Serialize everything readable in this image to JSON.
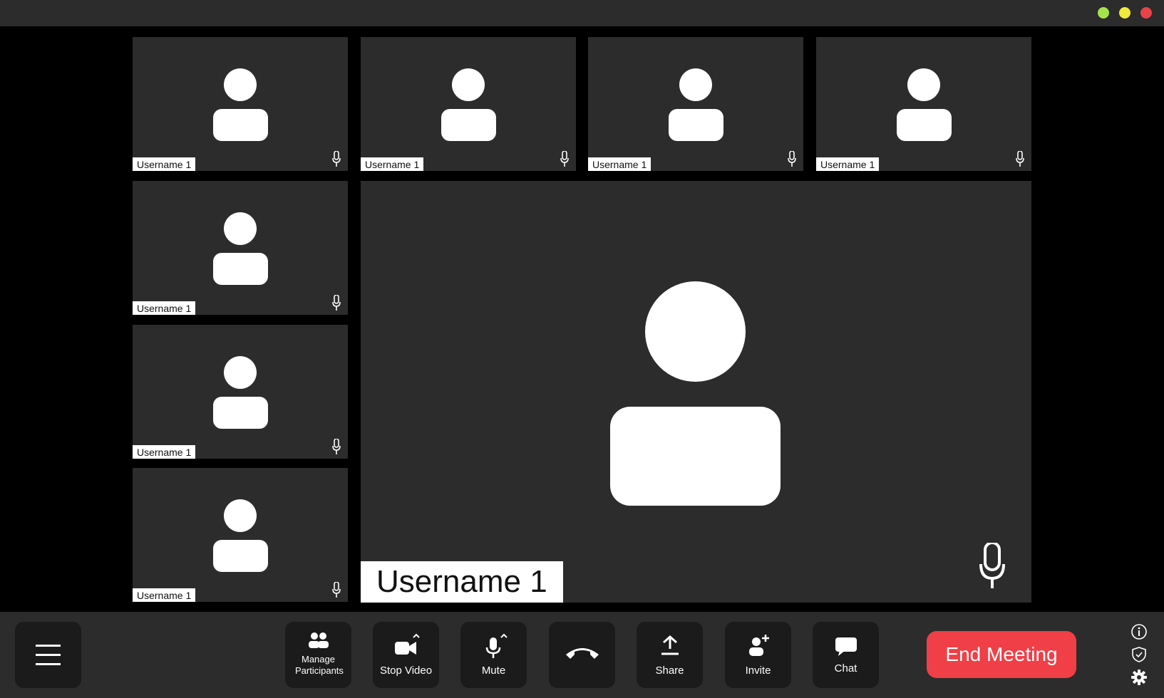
{
  "window": {
    "controls": [
      {
        "name": "green",
        "color": "#a5e34d"
      },
      {
        "name": "yellow",
        "color": "#f0ea3c"
      },
      {
        "name": "red",
        "color": "#e8434a"
      }
    ]
  },
  "tiles": [
    {
      "username": "Username 1"
    },
    {
      "username": "Username 1"
    },
    {
      "username": "Username 1"
    },
    {
      "username": "Username 1"
    },
    {
      "username": "Username 1"
    },
    {
      "username": "Username 1"
    },
    {
      "username": "Username 1"
    }
  ],
  "main_speaker": {
    "username": "Username 1"
  },
  "toolbar": {
    "menu_icon": "hamburger-menu-icon",
    "buttons": [
      {
        "label": "Manage Participants",
        "icon": "participants-icon"
      },
      {
        "label": "Stop Video",
        "icon": "video-camera-icon"
      },
      {
        "label": "Mute",
        "icon": "microphone-icon"
      },
      {
        "label": "",
        "icon": "hang-up-icon"
      },
      {
        "label": "Share",
        "icon": "share-upload-icon"
      },
      {
        "label": "Invite",
        "icon": "add-user-icon"
      },
      {
        "label": "Chat",
        "icon": "chat-bubble-icon"
      }
    ],
    "end_meeting_label": "End Meeting",
    "end_meeting_color": "#f03f47",
    "side_icons": [
      "info-icon",
      "shield-icon",
      "gear-icon"
    ]
  }
}
